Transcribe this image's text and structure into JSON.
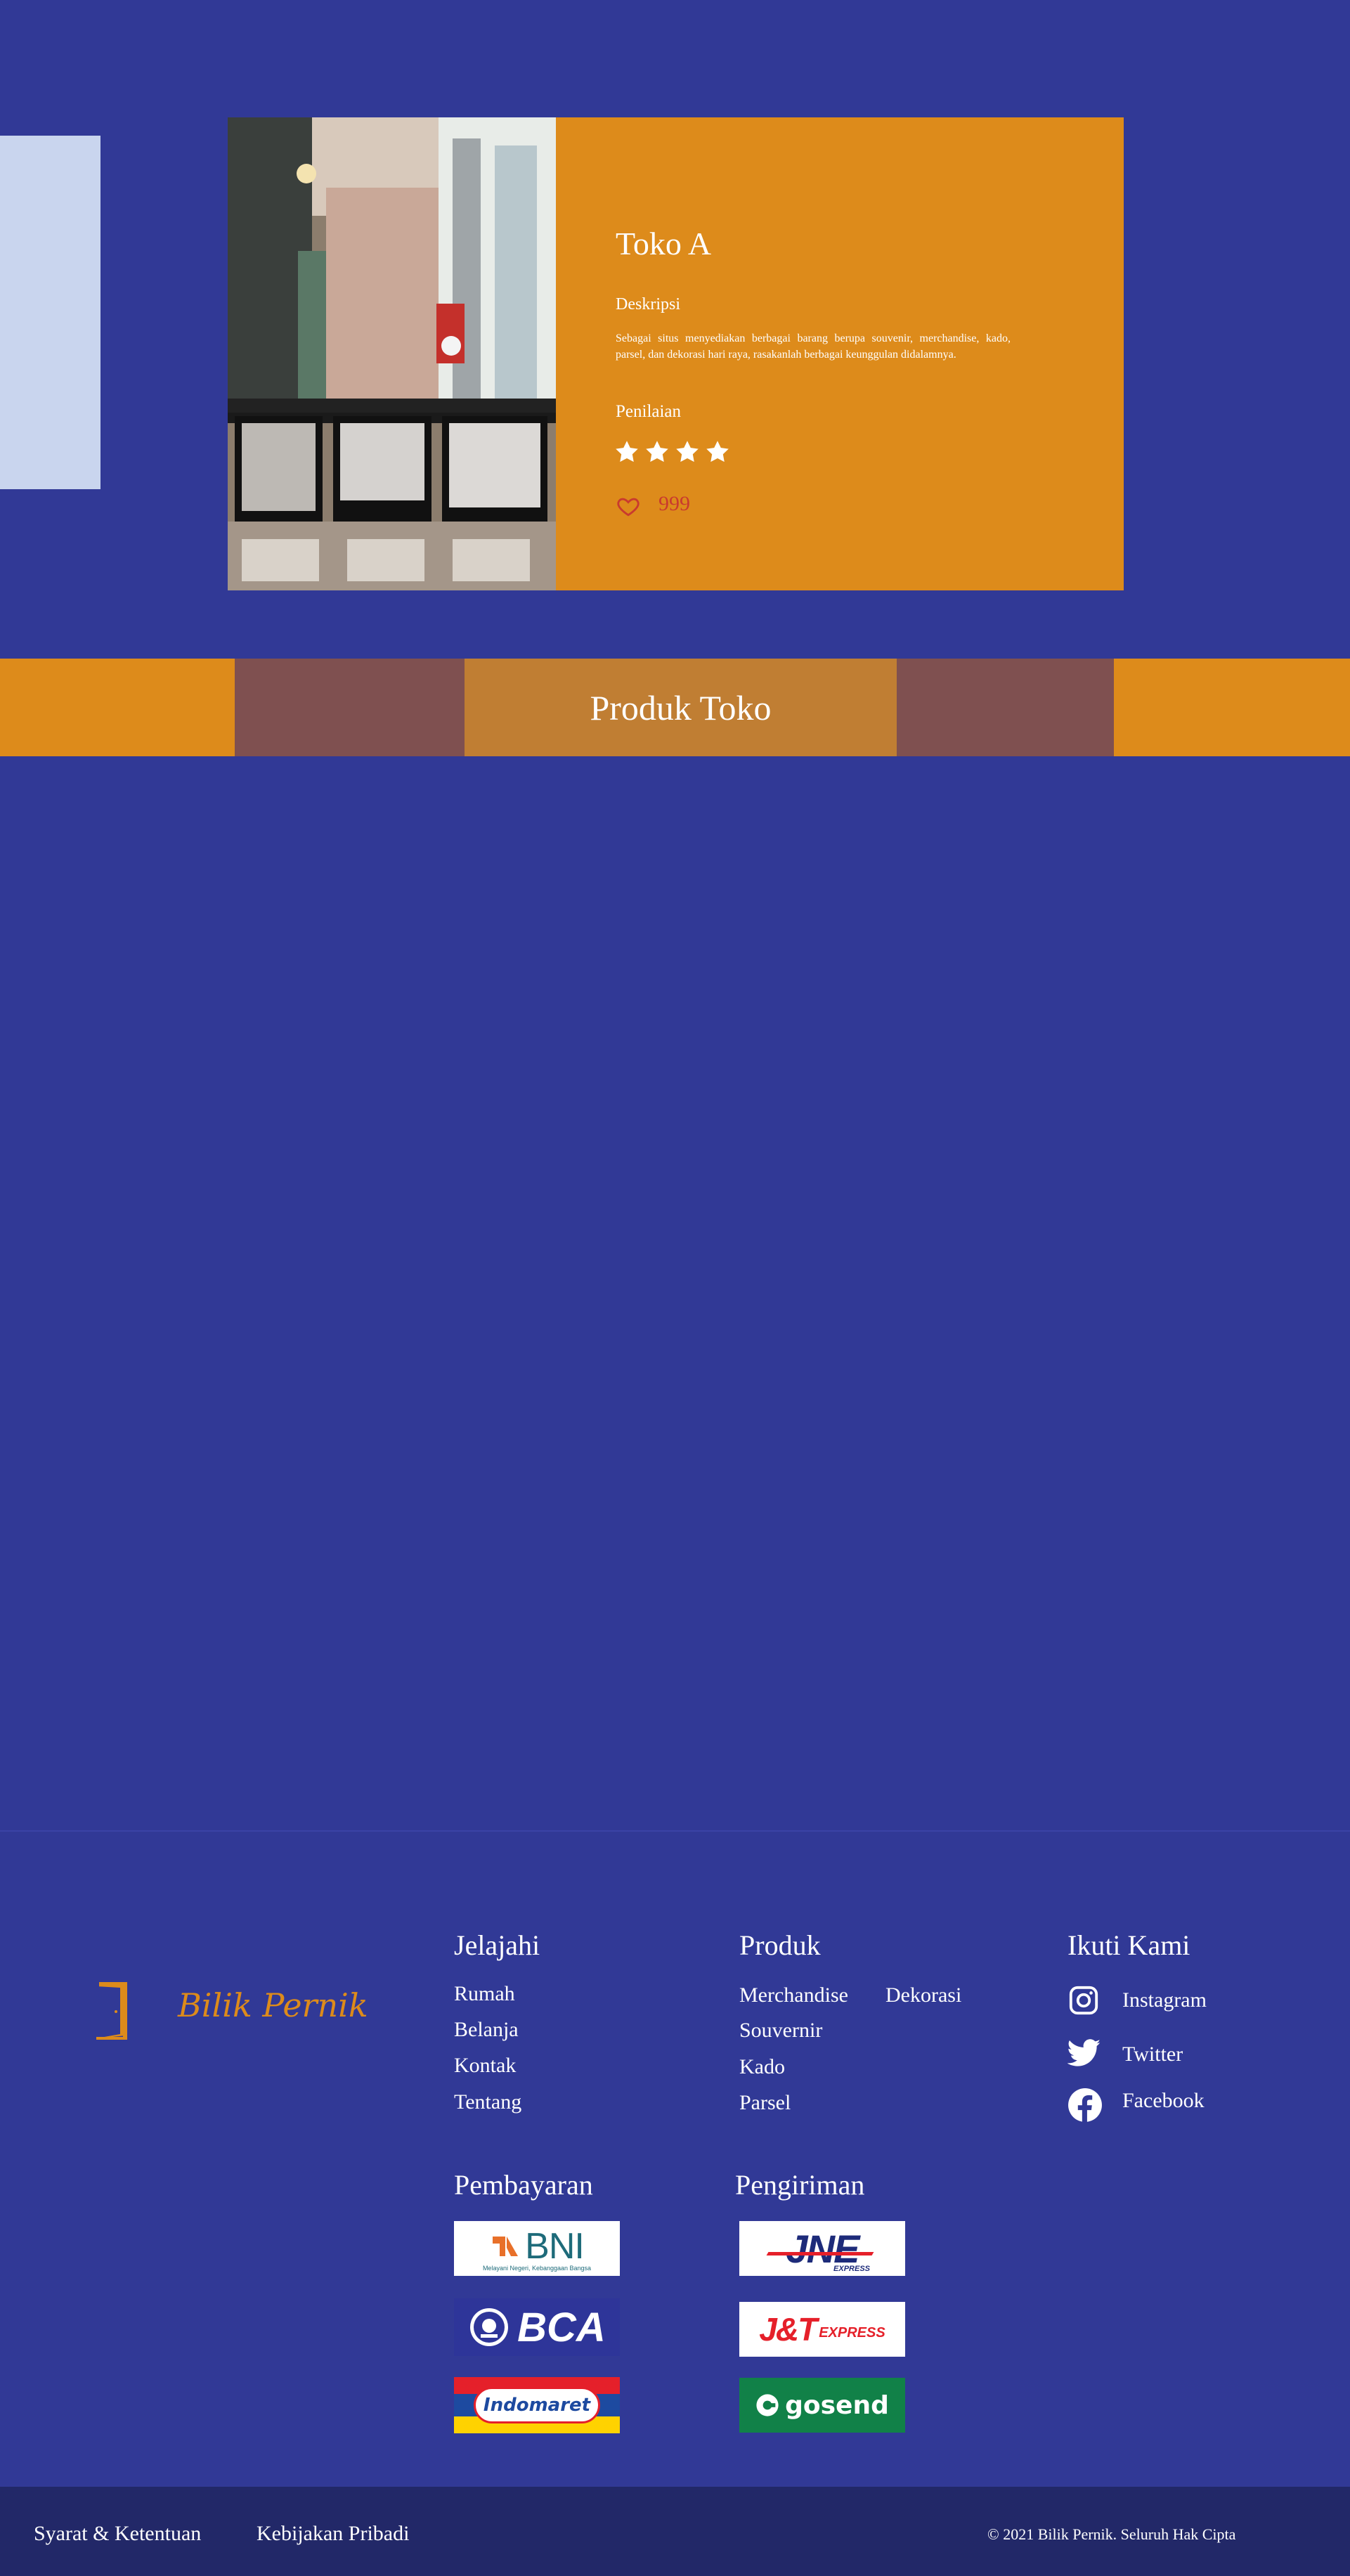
{
  "store": {
    "name": "Toko A",
    "description_label": "Deskripsi",
    "description": "Sebagai situs menyediakan berbagai barang berupa souvenir, merchandise, kado, parsel, dan dekorasi hari raya, rasakanlah berbagai keunggulan didalamnya.",
    "rating_label": "Penilaian",
    "rating": 4,
    "likes": "999"
  },
  "products_banner": {
    "title": "Produk Toko"
  },
  "footer": {
    "logo_text": "Bilik Pernik",
    "explore": {
      "title": "Jelajahi",
      "links": [
        "Rumah",
        "Belanja",
        "Kontak",
        "Tentang"
      ]
    },
    "products": {
      "title": "Produk",
      "links": [
        "Merchandise",
        "Dekorasi",
        "Souvernir",
        "Kado",
        "Parsel"
      ]
    },
    "follow": {
      "title": "Ikuti Kami",
      "links": [
        "Instagram",
        "Twitter",
        "Facebook"
      ]
    },
    "payment": {
      "title": "Pembayaran",
      "bni_tagline": "Melayani Negeri, Kebanggaan Bangsa",
      "bni_label": "BNI",
      "bca_label": "BCA",
      "indomaret_label": "Indomaret"
    },
    "shipping": {
      "title": "Pengiriman",
      "jne_label": "JNE",
      "jne_sub": "EXPRESS",
      "jt_label": "J&T",
      "jt_sub": "EXPRESS",
      "gosend_label": "gosend"
    }
  },
  "bottom_bar": {
    "terms": "Syarat & Ketentuan",
    "privacy": "Kebijakan Pribadi",
    "copyright": "© 2021 Bilik Pernik. Seluruh Hak Cipta"
  },
  "colors": {
    "background": "#313996",
    "accent_orange": "#dd8b1b",
    "bottom_bar": "#222868",
    "heart": "#c93a2e"
  }
}
